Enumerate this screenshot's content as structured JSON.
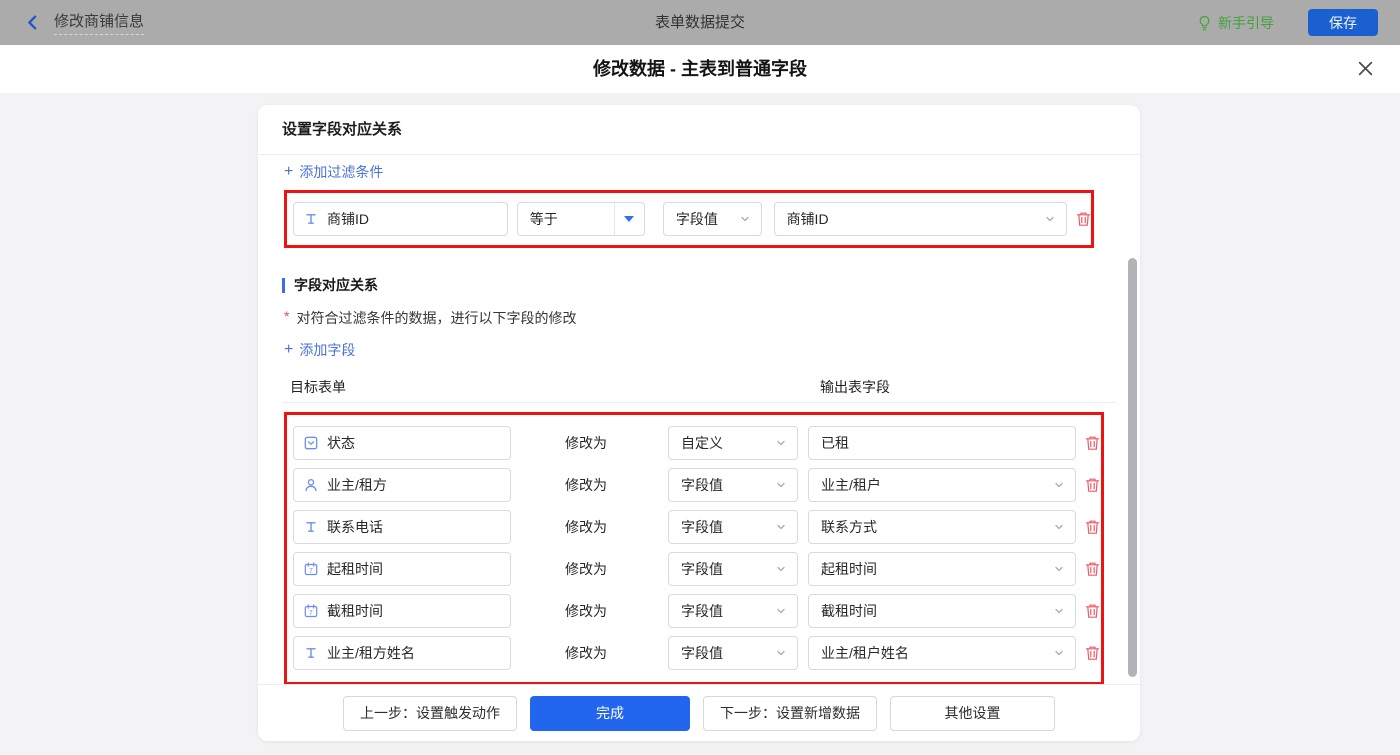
{
  "topbar": {
    "back_label": "修改商铺信息",
    "center_title": "表单数据提交",
    "guide_label": "新手引导",
    "save_label": "保存"
  },
  "dialog": {
    "title": "修改数据 - 主表到普通字段"
  },
  "card": {
    "header": "设置字段对应关系",
    "plus_sign": "+",
    "add_filter_label": "添加过滤条件",
    "filter_row": {
      "field": "商铺ID",
      "field_icon": "text-field-icon",
      "operator": "等于",
      "value_type": "字段值",
      "value": "商铺ID"
    },
    "mapping": {
      "title": "字段对应关系",
      "required_mark": "*",
      "desc": "对符合过滤条件的数据，进行以下字段的修改",
      "add_field_label": "添加字段",
      "col_left": "目标表单",
      "col_right": "输出表字段",
      "modify_label": "修改为",
      "rows": [
        {
          "field": "状态",
          "icon": "select-field-icon",
          "mode": "自定义",
          "value": "已租",
          "value_editor": "input"
        },
        {
          "field": "业主/租方",
          "icon": "member-field-icon",
          "mode": "字段值",
          "value": "业主/租户",
          "value_editor": "select"
        },
        {
          "field": "联系电话",
          "icon": "text-field-icon",
          "mode": "字段值",
          "value": "联系方式",
          "value_editor": "select"
        },
        {
          "field": "起租时间",
          "icon": "date-field-icon",
          "mode": "字段值",
          "value": "起租时间",
          "value_editor": "select"
        },
        {
          "field": "截租时间",
          "icon": "date-field-icon",
          "mode": "字段值",
          "value": "截租时间",
          "value_editor": "select"
        },
        {
          "field": "业主/租方姓名",
          "icon": "text-field-icon",
          "mode": "字段值",
          "value": "业主/租户姓名",
          "value_editor": "select"
        }
      ]
    },
    "footer_buttons": [
      {
        "label": "上一步：设置触发动作",
        "primary": false
      },
      {
        "label": "完成",
        "primary": true
      },
      {
        "label": "下一步：设置新增数据",
        "primary": false
      },
      {
        "label": "其他设置",
        "primary": false
      }
    ]
  },
  "colors": {
    "highlight_border": "#f01212",
    "primary_blue": "#2166ec",
    "link_blue": "#4a72d9",
    "guide_green": "#43a23c",
    "danger_red": "#ef5864",
    "topbar_bg": "#ababab"
  }
}
